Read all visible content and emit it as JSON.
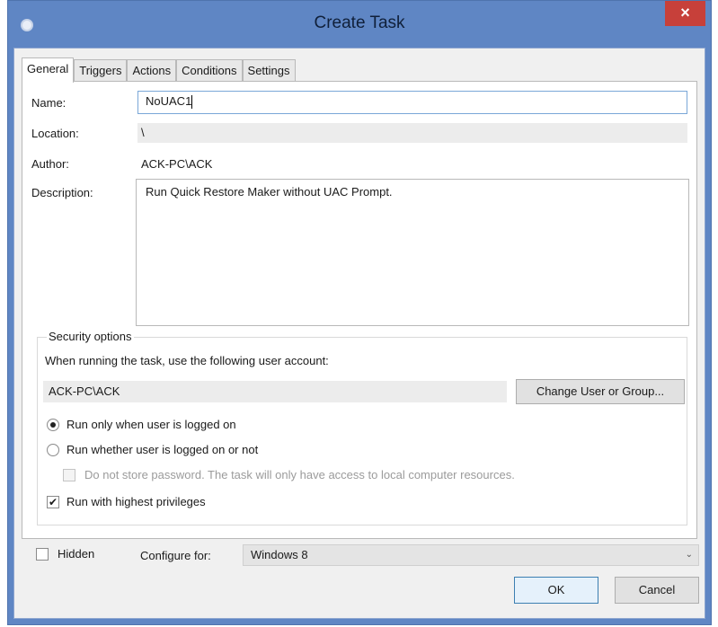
{
  "window": {
    "title": "Create Task",
    "close_label": "×"
  },
  "tabs": [
    "General",
    "Triggers",
    "Actions",
    "Conditions",
    "Settings"
  ],
  "general": {
    "name_label": "Name:",
    "name_value": "NoUAC1",
    "location_label": "Location:",
    "location_value": "\\",
    "author_label": "Author:",
    "author_value": "ACK-PC\\ACK",
    "description_label": "Description:",
    "description_value": "Run Quick Restore Maker without UAC Prompt."
  },
  "security": {
    "title": "Security options",
    "account_prompt": "When running the task, use the following user account:",
    "account_value": "ACK-PC\\ACK",
    "change_button": "Change User or Group...",
    "radio_logged_on": "Run only when user is logged on",
    "radio_whether": "Run whether user is logged on or not",
    "do_not_store": "Do not store password.  The task will only have access to local computer resources.",
    "highest_privileges": "Run with highest privileges"
  },
  "bottom": {
    "hidden_label": "Hidden",
    "configure_label": "Configure for:",
    "configure_value": "Windows 8",
    "ok_button": "OK",
    "cancel_button": "Cancel"
  }
}
